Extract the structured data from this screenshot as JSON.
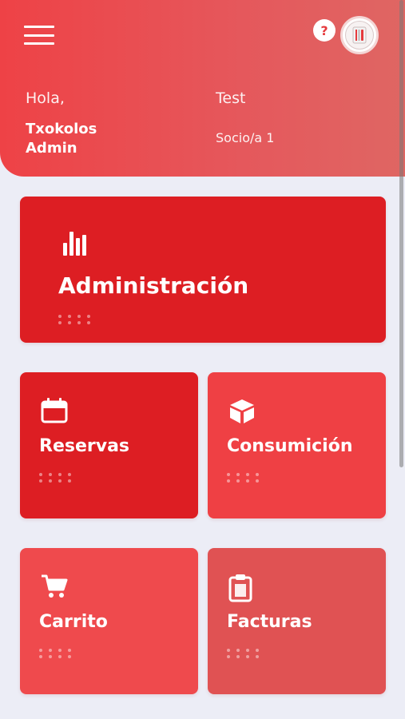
{
  "header": {
    "greeting": "Hola,",
    "user_name": "Txokolos Admin",
    "test_label": "Test",
    "role_label": "Socio/a 1",
    "help_label": "?"
  },
  "cards": {
    "admin": {
      "label": "Administración",
      "icon": "bar-chart-icon"
    },
    "reservas": {
      "label": "Reservas",
      "icon": "calendar-icon"
    },
    "consumicion": {
      "label": "Consumición",
      "icon": "box-icon"
    },
    "carrito": {
      "label": "Carrito",
      "icon": "cart-icon"
    },
    "facturas": {
      "label": "Facturas",
      "icon": "clipboard-icon"
    }
  },
  "colors": {
    "primary": "#dd1e23",
    "secondary": "#ef4044",
    "header": "#ee4246",
    "background": "#ecedf6"
  }
}
